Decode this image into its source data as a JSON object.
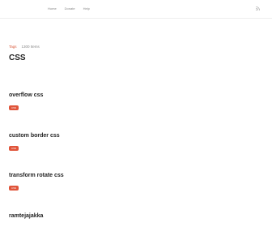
{
  "nav": {
    "items": [
      "Home",
      "Donate",
      "Help"
    ]
  },
  "header": {
    "rss_icon": "rss-icon"
  },
  "breadcrumb": {
    "tags_label": "Tags",
    "count": "1300 Items"
  },
  "page": {
    "title": "CSS"
  },
  "posts": [
    {
      "title": "overflow css",
      "tag": "CSS"
    },
    {
      "title": "custom border css",
      "tag": "CSS"
    },
    {
      "title": "transform rotate css",
      "tag": "CSS"
    },
    {
      "title": "ramtejajakka",
      "tag": ""
    }
  ],
  "colors": {
    "accent": "#e0543a",
    "link": "#d9593a",
    "muted": "#888888"
  }
}
